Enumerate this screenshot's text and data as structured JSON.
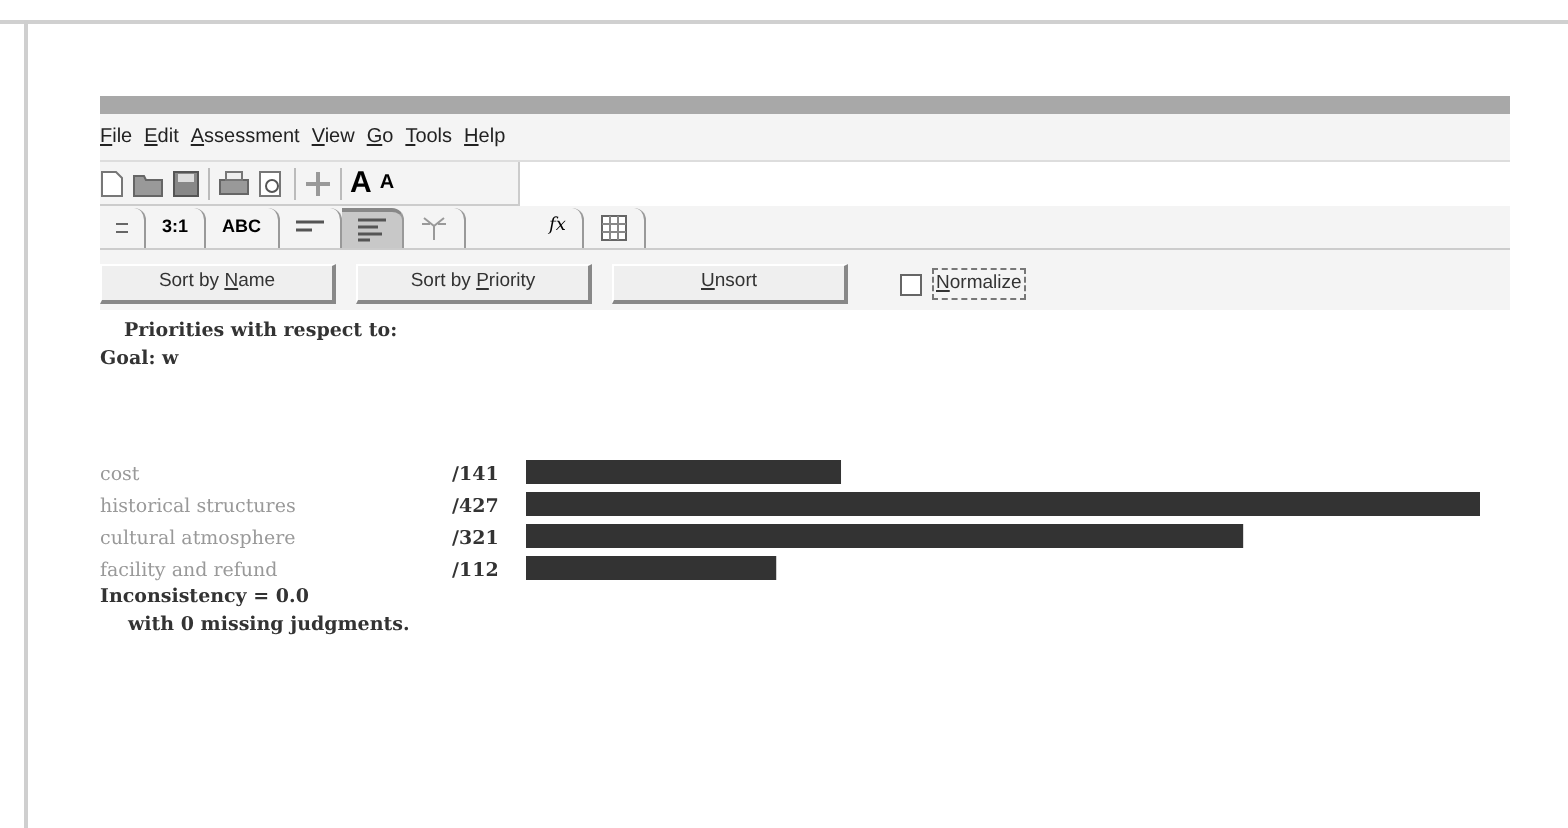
{
  "menu": [
    {
      "key": "F",
      "post": "ile"
    },
    {
      "key": "E",
      "post": "dit"
    },
    {
      "key": "A",
      "post": "ssessment"
    },
    {
      "key": "V",
      "post": "iew"
    },
    {
      "key": "G",
      "post": "o"
    },
    {
      "key": "T",
      "post": "ools"
    },
    {
      "key": "H",
      "post": "elp"
    }
  ],
  "toolbar": [
    {
      "kind": "new"
    },
    {
      "kind": "open"
    },
    {
      "kind": "save"
    },
    {
      "kind": "sep"
    },
    {
      "kind": "print"
    },
    {
      "kind": "preview"
    },
    {
      "kind": "sep"
    },
    {
      "kind": "move"
    },
    {
      "kind": "sep"
    },
    {
      "kind": "font-up",
      "label": "A"
    },
    {
      "kind": "font-down",
      "label": "A"
    }
  ],
  "tabs": [
    {
      "kind": "wave",
      "selected": false
    },
    {
      "kind": "text",
      "label": "3:1",
      "selected": false
    },
    {
      "kind": "text",
      "label": "ABC",
      "selected": false
    },
    {
      "kind": "lines",
      "selected": false
    },
    {
      "kind": "bars",
      "selected": true
    },
    {
      "kind": "tree",
      "selected": false
    },
    {
      "kind": "fx",
      "label": "fx",
      "selected": false
    },
    {
      "kind": "grid",
      "selected": false
    }
  ],
  "sort_buttons": [
    {
      "pre": "Sort by ",
      "key": "N",
      "post": "ame"
    },
    {
      "pre": "Sort by ",
      "key": "P",
      "post": "riority"
    },
    {
      "key": "U",
      "post": "nsort"
    }
  ],
  "normalize": {
    "key": "N",
    "post": "ormalize",
    "checked": false
  },
  "heading": "Priorities with respect to:",
  "goal": "Goal: w",
  "priorities": {
    "chart_data": {
      "type": "bar",
      "orientation": "horizontal",
      "categories": [
        "cost",
        "historical structures",
        "cultural atmosphere",
        "facility and refund"
      ],
      "values": [
        141,
        427,
        321,
        112
      ],
      "value_labels": [
        "/141",
        "/427",
        "/321",
        "/112"
      ]
    }
  },
  "inconsistency": "Inconsistency = 0.0",
  "missing": "with 0  missing judgments."
}
